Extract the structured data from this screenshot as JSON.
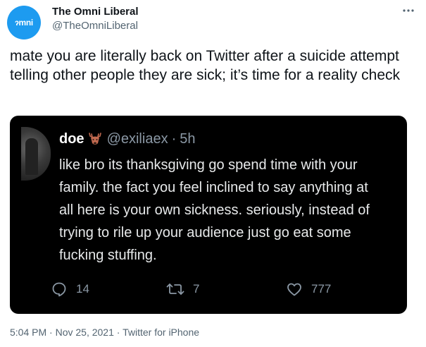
{
  "author": {
    "display_name": "The Omni Liberal",
    "handle": "@TheOmniLiberal",
    "avatar_text": "ɂmni",
    "avatar_color": "#1d9bf0"
  },
  "tweet": {
    "text": "mate you are literally back on Twitter after a suicide attempt telling other people they are sick; it’s time for a reality check"
  },
  "quoted": {
    "name": "doe",
    "emoji": "deer-emoji",
    "handle": "@exiliaex",
    "separator": "·",
    "time": "5h",
    "lines": [
      "like bro its thanksgiving go spend time with your",
      "family. the fact you feel inclined to say anything at",
      "all here is your own sickness. seriously, instead of",
      "trying to rile up your audience just go eat some",
      "fucking stuffing."
    ],
    "reply_count": "14",
    "retweet_count": "7",
    "like_count": "777",
    "card_background": "#000000"
  },
  "meta": {
    "time": "5:04 PM",
    "sep1": "·",
    "date": "Nov 25, 2021",
    "sep2": "·",
    "source": "Twitter for iPhone"
  },
  "icons": {
    "more": "more-icon",
    "reply": "reply-icon",
    "retweet": "retweet-icon",
    "like": "heart-icon"
  }
}
